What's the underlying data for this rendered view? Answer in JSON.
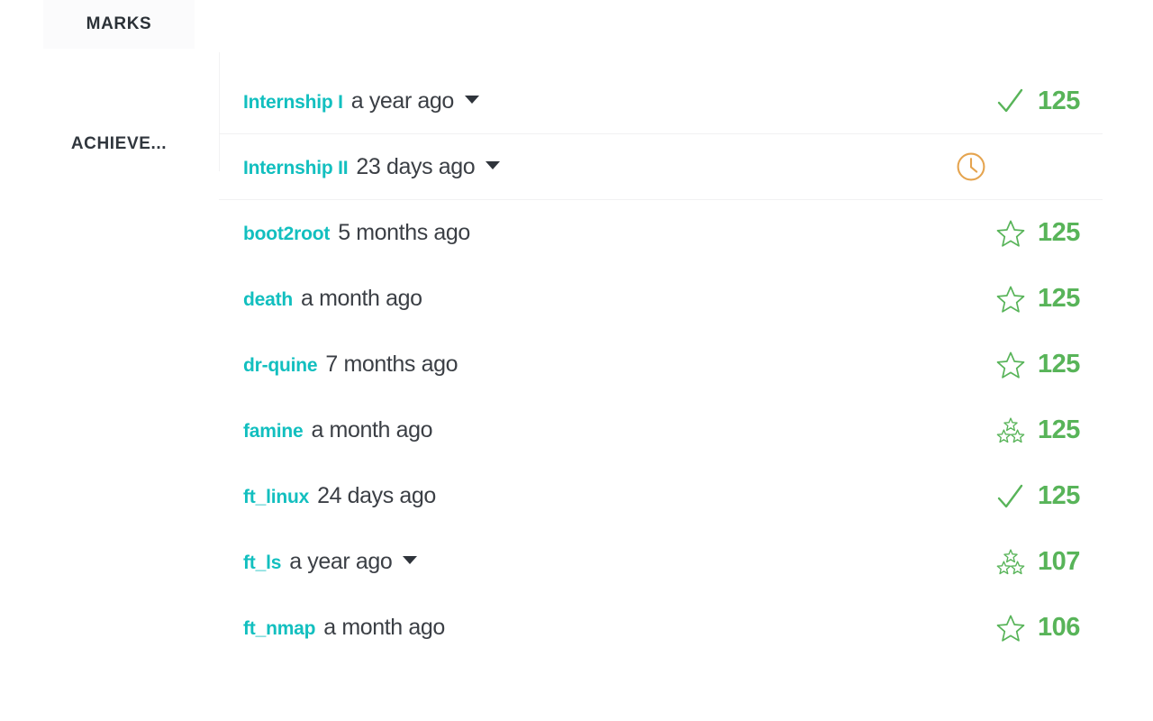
{
  "theme": {
    "teal": "#12bfbf",
    "green": "#58b459",
    "orange": "#e5a44f",
    "text_dark": "#3b3f45",
    "divider": "#f1f1f2",
    "active_bg": "#fbfbfc"
  },
  "sidebar": {
    "items": [
      {
        "label": "MARKS",
        "name": "sidebar-item-marks",
        "active": true
      },
      {
        "label": "ACHIEVE...",
        "name": "sidebar-item-achievements",
        "active": false
      }
    ]
  },
  "projects": [
    {
      "name": "Internship I",
      "date": "a year ago",
      "has_caret": true,
      "icon": "check-icon",
      "value": "125",
      "divider": true
    },
    {
      "name": "Internship II",
      "date": "23 days ago",
      "has_caret": true,
      "icon": "clock-icon",
      "value": "",
      "divider": true
    },
    {
      "name": "boot2root",
      "date": "5 months ago",
      "has_caret": false,
      "icon": "star-single-icon",
      "value": "125",
      "divider": false
    },
    {
      "name": "death",
      "date": "a month ago",
      "has_caret": false,
      "icon": "star-single-icon",
      "value": "125",
      "divider": false
    },
    {
      "name": "dr-quine",
      "date": "7 months ago",
      "has_caret": false,
      "icon": "star-single-icon",
      "value": "125",
      "divider": false
    },
    {
      "name": "famine",
      "date": "a month ago",
      "has_caret": false,
      "icon": "star-triple-icon",
      "value": "125",
      "divider": false
    },
    {
      "name": "ft_linux",
      "date": "24 days ago",
      "has_caret": false,
      "icon": "check-icon",
      "value": "125",
      "divider": false
    },
    {
      "name": "ft_ls",
      "date": "a year ago",
      "has_caret": true,
      "icon": "star-triple-icon",
      "value": "107",
      "divider": false
    },
    {
      "name": "ft_nmap",
      "date": "a month ago",
      "has_caret": false,
      "icon": "star-single-icon",
      "value": "106",
      "divider": false
    }
  ]
}
